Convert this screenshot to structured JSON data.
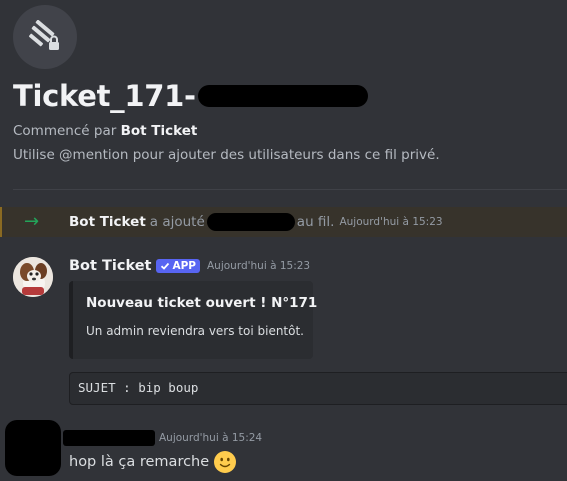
{
  "thread": {
    "icon": "thread-lock-icon",
    "title_prefix": "Ticket_171-",
    "started_by_prefix": "Commencé par",
    "started_by_name": "Bot Ticket",
    "hint": "Utilise @mention pour ajouter des utilisateurs dans ce fil privé."
  },
  "system_message": {
    "icon": "arrow-right-icon",
    "author": "Bot Ticket",
    "text_before": "a ajouté",
    "text_after": "au fil.",
    "timestamp": "Aujourd'hui à 15:23"
  },
  "bot_message": {
    "author": "Bot Ticket",
    "badge": "APP",
    "timestamp": "Aujourd'hui à 15:23",
    "embed": {
      "title": "Nouveau ticket ouvert ! N°171",
      "description": "Un admin reviendra vers toi bientôt."
    },
    "code": "SUJET : bip boup"
  },
  "user_message": {
    "timestamp": "Aujourd'hui à 15:24",
    "text": "hop là ça remarche",
    "emoji": "slightly-smiling-face-icon"
  },
  "colors": {
    "background": "#313338",
    "accent": "#5865f2",
    "join_arrow": "#23a55a",
    "highlight_bg": "#37332b"
  }
}
